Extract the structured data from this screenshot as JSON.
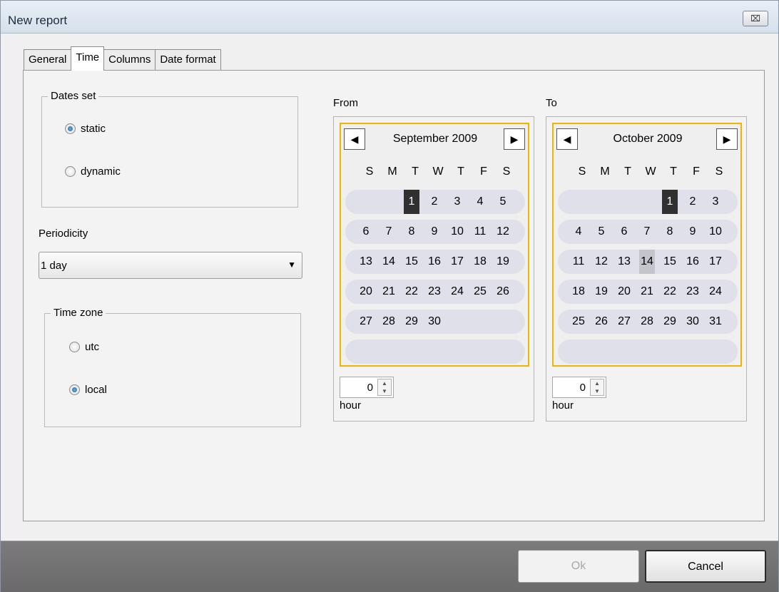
{
  "window": {
    "title": "New report",
    "close_glyph": "⌧"
  },
  "tabs": [
    "General",
    "Time",
    "Columns",
    "Date format"
  ],
  "dates_set": {
    "legend": "Dates set",
    "options": [
      "static",
      "dynamic"
    ],
    "selected": "static"
  },
  "periodicity": {
    "label": "Periodicity",
    "value": "1 day"
  },
  "time_zone": {
    "legend": "Time zone",
    "options": [
      "utc",
      "local"
    ],
    "selected": "local"
  },
  "from": {
    "label": "From",
    "month": "September 2009",
    "dow": [
      "S",
      "M",
      "T",
      "W",
      "T",
      "F",
      "S"
    ],
    "weeks": [
      [
        "",
        "",
        "",
        "1",
        "2",
        "3",
        "4",
        "5"
      ],
      [
        "6",
        "7",
        "8",
        "9",
        "10",
        "11",
        "12"
      ],
      [
        "13",
        "14",
        "15",
        "16",
        "17",
        "18",
        "19"
      ],
      [
        "20",
        "21",
        "22",
        "23",
        "24",
        "25",
        "26"
      ],
      [
        "27",
        "28",
        "29",
        "30",
        "",
        "",
        ""
      ],
      [
        "",
        "",
        "",
        "",
        "",
        "",
        ""
      ]
    ],
    "selected_day": "1",
    "hour_value": "0",
    "hour_label": "hour"
  },
  "to": {
    "label": "To",
    "month": "October 2009",
    "dow": [
      "S",
      "M",
      "T",
      "W",
      "T",
      "F",
      "S"
    ],
    "weeks": [
      [
        "",
        "",
        "",
        "",
        "1",
        "2",
        "3"
      ],
      [
        "4",
        "5",
        "6",
        "7",
        "8",
        "9",
        "10"
      ],
      [
        "11",
        "12",
        "13",
        "14",
        "15",
        "16",
        "17"
      ],
      [
        "18",
        "19",
        "20",
        "21",
        "22",
        "23",
        "24"
      ],
      [
        "25",
        "26",
        "27",
        "28",
        "29",
        "30",
        "31"
      ],
      [
        "",
        "",
        "",
        "",
        "",
        "",
        ""
      ]
    ],
    "selected_day": "1",
    "today_day": "14",
    "hour_value": "0",
    "hour_label": "hour"
  },
  "buttons": {
    "ok": "Ok",
    "cancel": "Cancel"
  }
}
